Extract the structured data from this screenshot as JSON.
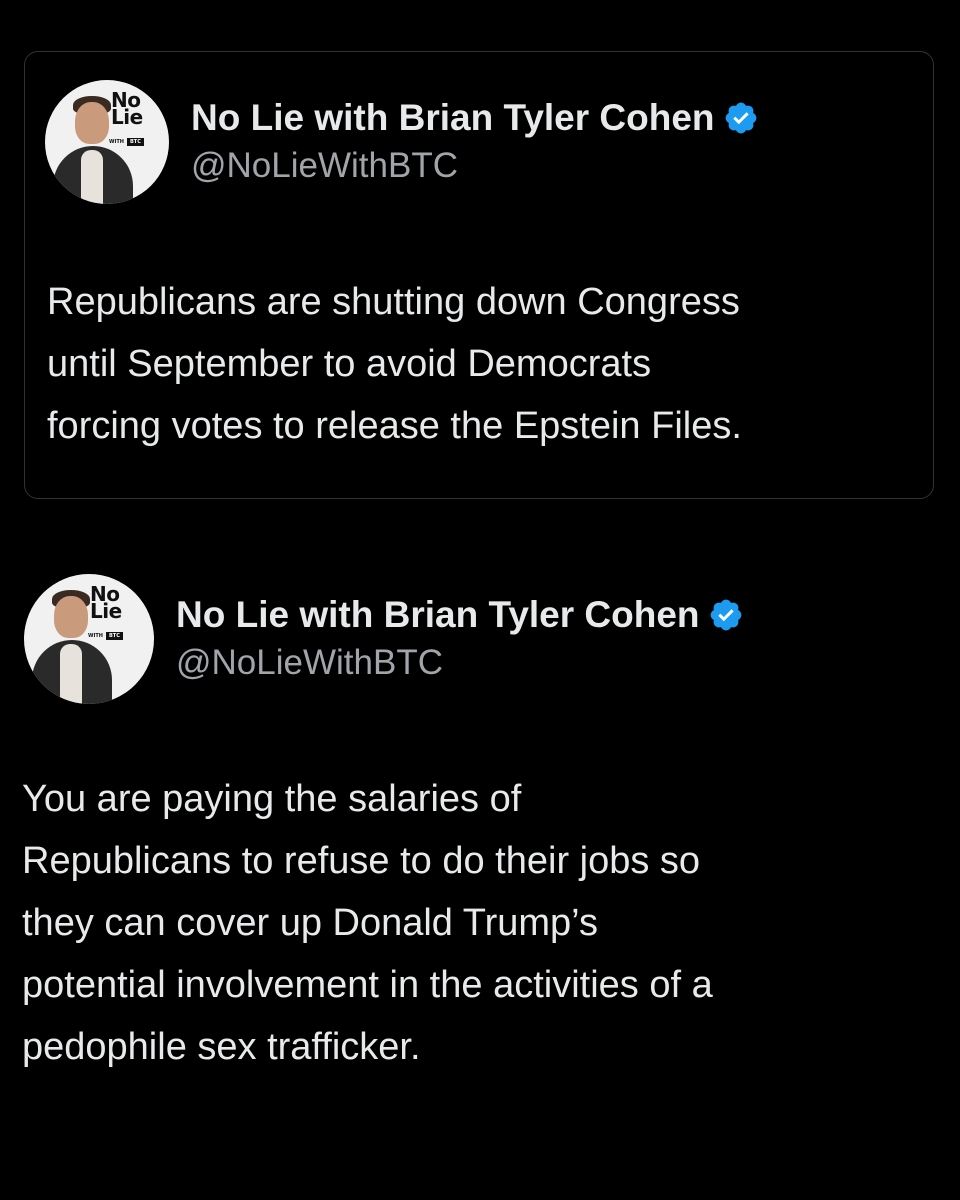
{
  "quoted_tweet": {
    "account": {
      "display_name": "No Lie with Brian Tyler Cohen",
      "handle": "@NoLieWithBTC",
      "verified": true,
      "verified_icon": "verified-badge-icon",
      "avatar_logo": "No Lie",
      "avatar_logo_sub_left": "WITH",
      "avatar_logo_sub_right": "BTC"
    },
    "text": "Republicans are shutting down Congress\nuntil September to avoid Democrats\nforcing votes to release the Epstein Files."
  },
  "main_tweet": {
    "account": {
      "display_name": "No Lie with Brian Tyler Cohen",
      "handle": "@NoLieWithBTC",
      "verified": true,
      "verified_icon": "verified-badge-icon",
      "avatar_logo": "No Lie",
      "avatar_logo_sub_left": "WITH",
      "avatar_logo_sub_right": "BTC"
    },
    "text": "You are paying the salaries of\nRepublicans to refuse to do their jobs so\nthey can cover up Donald Trump’s\npotential involvement in the activities of a\npedophile sex trafficker."
  },
  "colors": {
    "background": "#000000",
    "text_primary": "#e7e9ea",
    "text_secondary": "#a0a5aa",
    "verified_blue": "#1d9bf0",
    "card_border": "#2f3336"
  }
}
